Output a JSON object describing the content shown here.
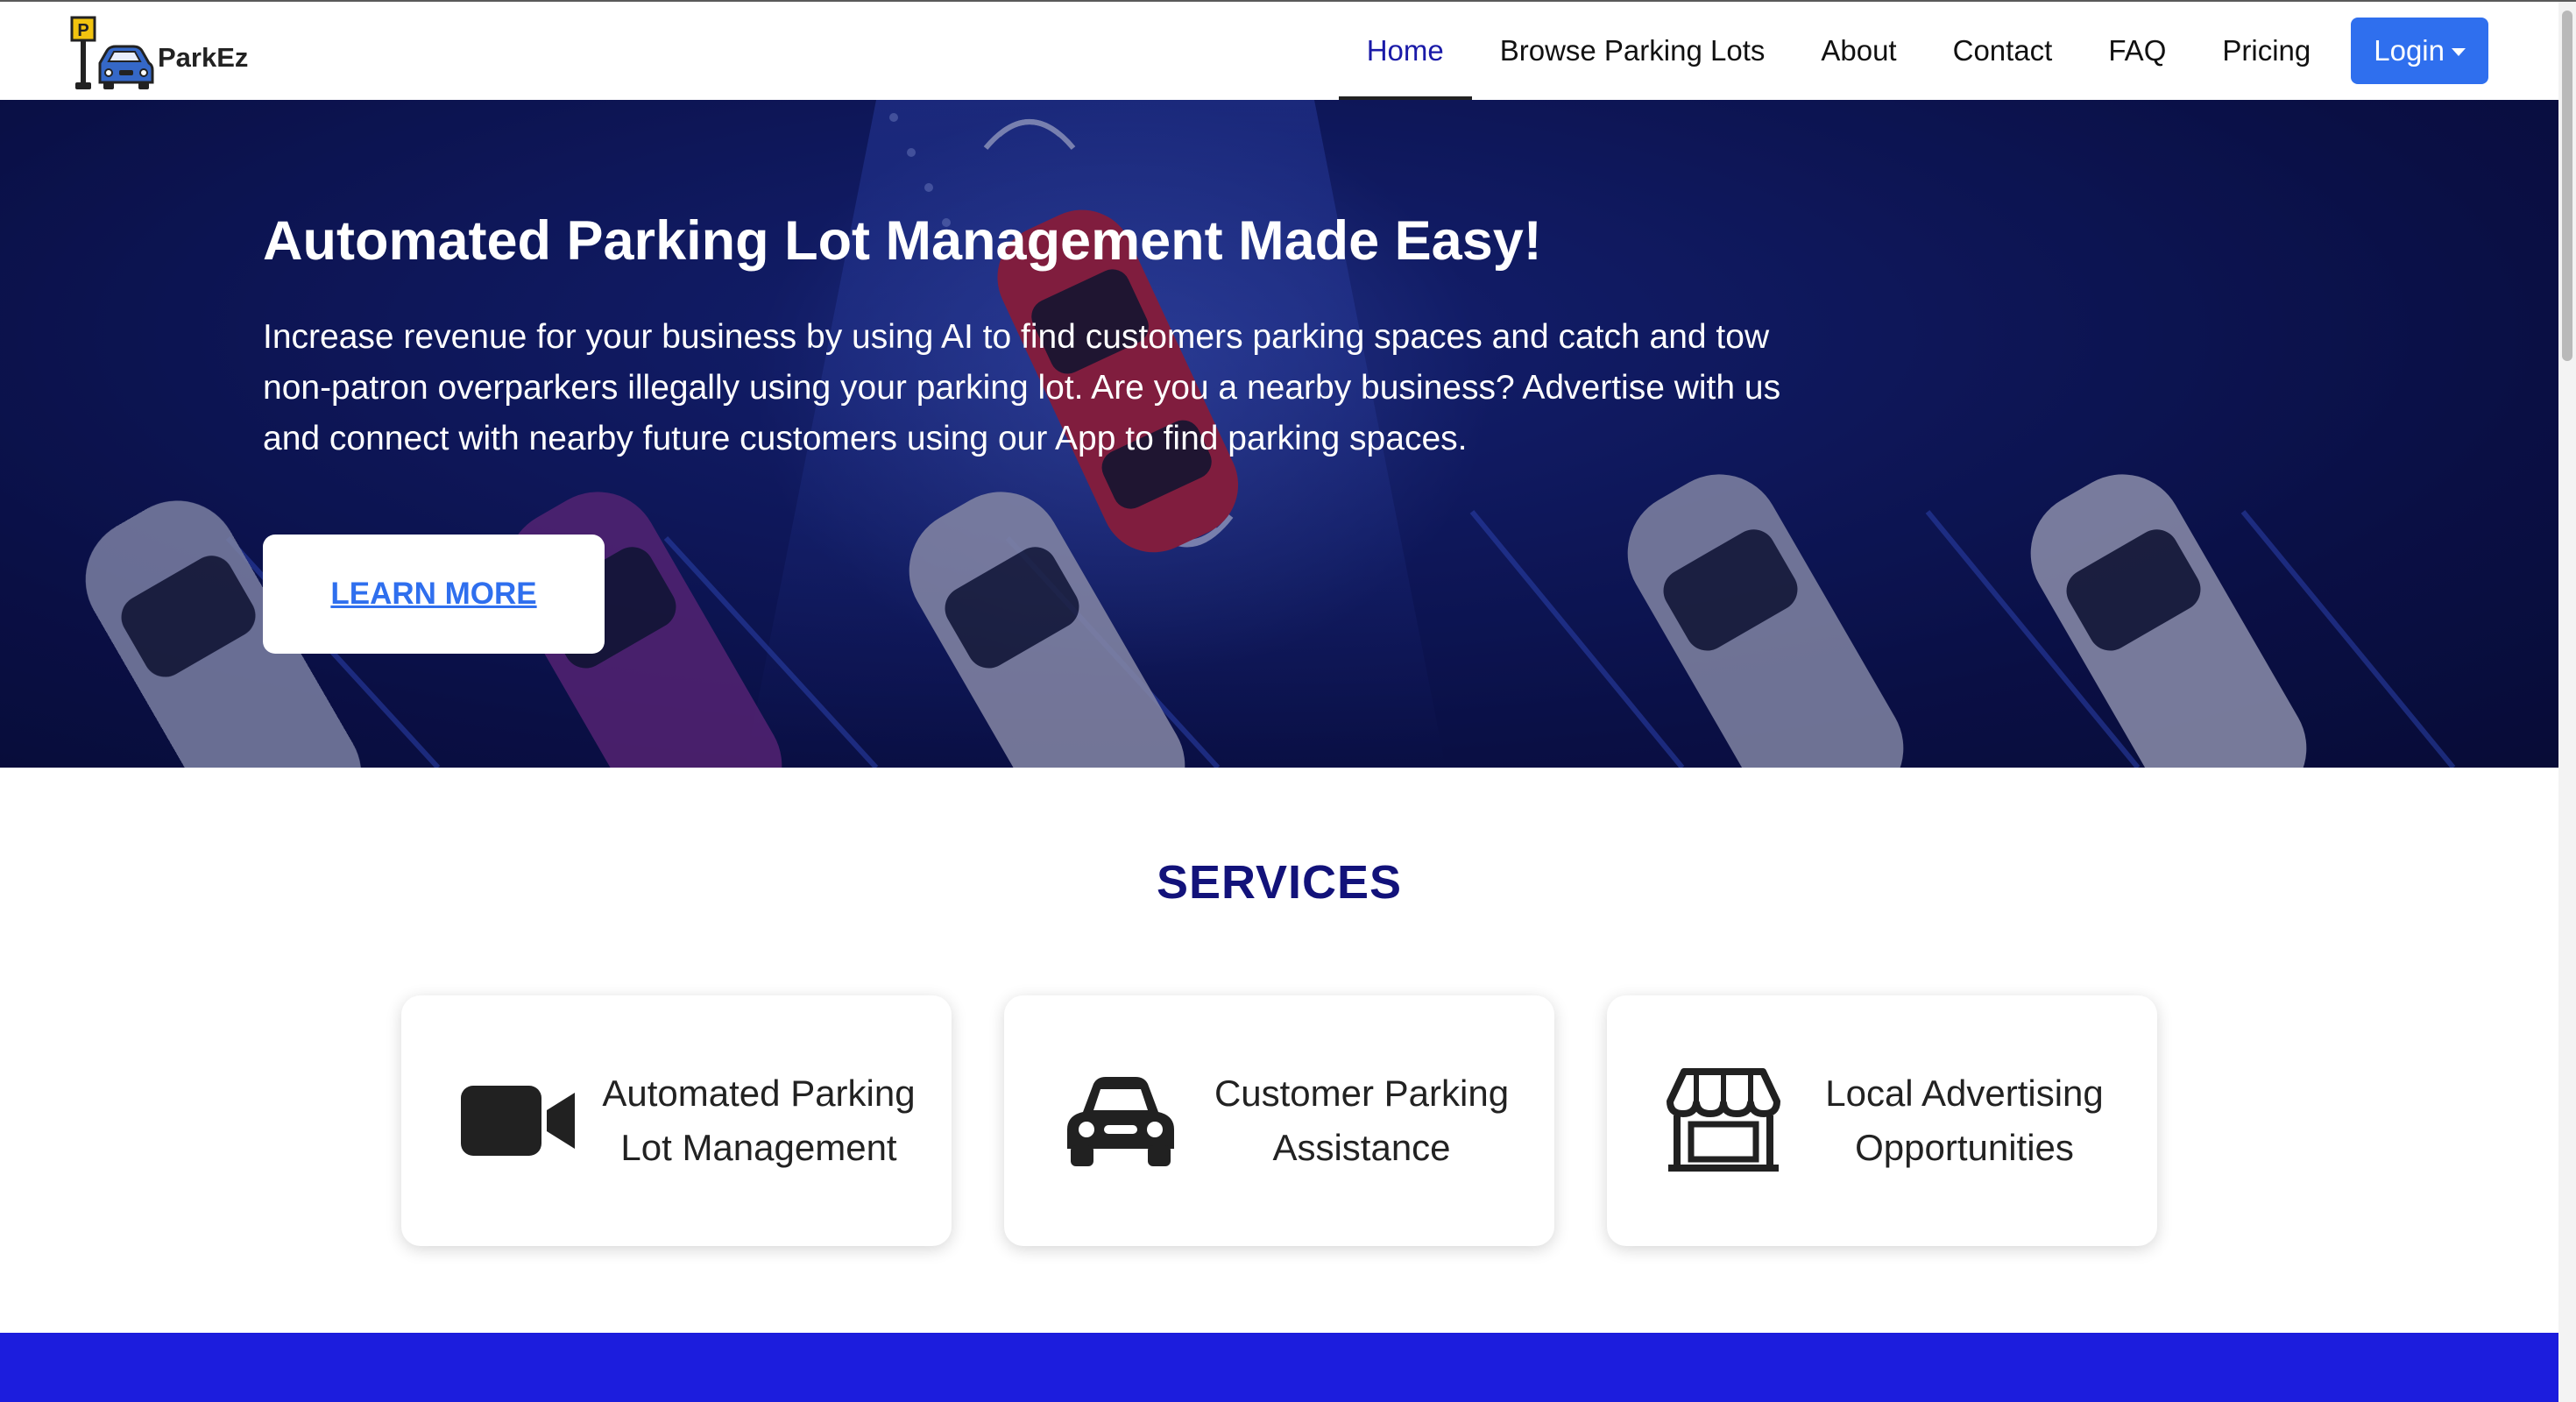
{
  "brand": {
    "name": "ParkEz",
    "logo_sign_letter": "P"
  },
  "nav": {
    "items": [
      {
        "label": "Home",
        "active": true
      },
      {
        "label": "Browse Parking Lots",
        "active": false
      },
      {
        "label": "About",
        "active": false
      },
      {
        "label": "Contact",
        "active": false
      },
      {
        "label": "FAQ",
        "active": false
      },
      {
        "label": "Pricing",
        "active": false
      }
    ],
    "login_label": "Login"
  },
  "hero": {
    "title": "Automated Parking Lot Management Made Easy!",
    "text": "Increase revenue for your business by using AI to find customers parking spaces and catch and tow non-patron overparkers illegally using your parking lot. Are you a nearby business? Advertise with us and connect with nearby future customers using our App to find parking spaces.",
    "button_label": "LEARN MORE"
  },
  "services": {
    "title": "SERVICES",
    "cards": [
      {
        "icon": "video-camera-icon",
        "label": "Automated Parking Lot Management"
      },
      {
        "icon": "car-icon",
        "label": "Customer Parking Assistance"
      },
      {
        "icon": "store-icon",
        "label": "Local Advertising Opportunities"
      }
    ]
  },
  "colors": {
    "accent": "#2f6fee",
    "nav_active": "#1a1aa8",
    "services_title": "#12127a",
    "footer_band": "#1c1ddd",
    "hero_bg": "#0b1048"
  }
}
